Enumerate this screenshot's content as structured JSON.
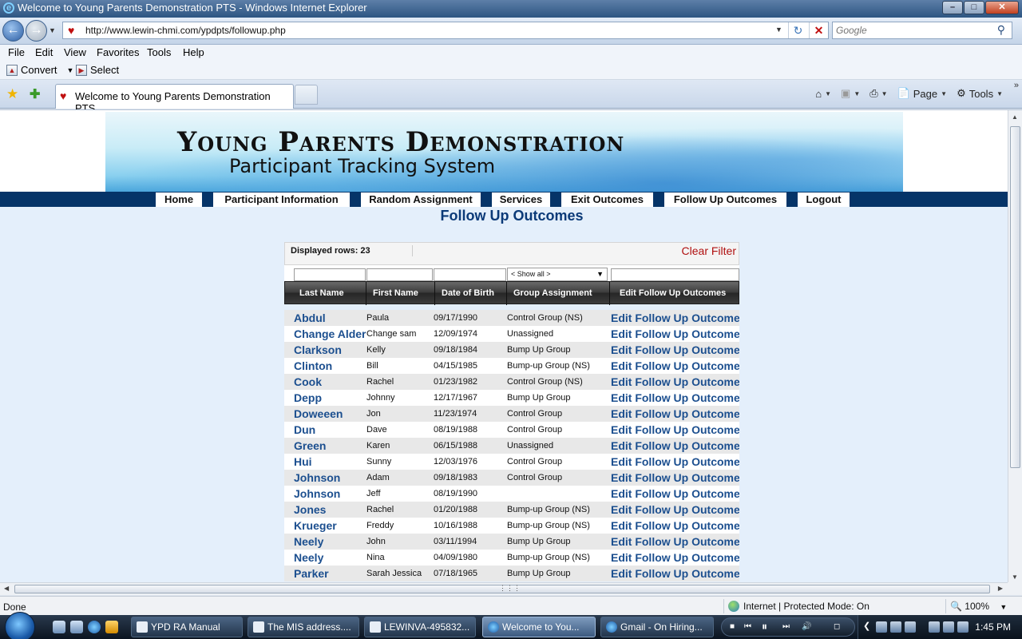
{
  "window": {
    "title": "Welcome to Young Parents Demonstration PTS - Windows Internet Explorer",
    "min": "–",
    "max": "□",
    "close": "✕"
  },
  "browser": {
    "url": "http://www.lewin-chmi.com/ypdpts/followup.php",
    "search_placeholder": "Google",
    "menu": [
      "File",
      "Edit",
      "View",
      "Favorites",
      "Tools",
      "Help"
    ],
    "cmd_convert": "Convert",
    "cmd_select": "Select",
    "tab_title": "Welcome to Young Parents Demonstration PTS",
    "tool_page": "Page",
    "tool_tools": "Tools"
  },
  "banner": {
    "title": "Young Parents Demonstration",
    "subtitle": "Participant Tracking System"
  },
  "site_nav": [
    "Home",
    "Participant Information",
    "Random Assignment",
    "Services",
    "Exit Outcomes",
    "Follow Up Outcomes",
    "Logout"
  ],
  "page_title": "Follow Up Outcomes",
  "grid": {
    "displayed_rows": "Displayed rows: 23",
    "clear_filter": "Clear Filter",
    "group_filter": "< Show all >",
    "columns": [
      "Last Name",
      "First Name",
      "Date of Birth",
      "Group Assignment",
      "Edit Follow Up Outcomes"
    ],
    "edit_link": "Edit Follow Up Outcomes",
    "rows": [
      [
        "Abdul",
        "Paula",
        "09/17/1990",
        "Control Group (NS)"
      ],
      [
        "Change Alder",
        "Change sam",
        "12/09/1974",
        "Unassigned"
      ],
      [
        "Clarkson",
        "Kelly",
        "09/18/1984",
        "Bump Up Group"
      ],
      [
        "Clinton",
        "Bill",
        "04/15/1985",
        "Bump-up Group (NS)"
      ],
      [
        "Cook",
        "Rachel",
        "01/23/1982",
        "Control Group (NS)"
      ],
      [
        "Depp",
        "Johnny",
        "12/17/1967",
        "Bump Up Group"
      ],
      [
        "Doweeen",
        "Jon",
        "11/23/1974",
        "Control Group"
      ],
      [
        "Dun",
        "Dave",
        "08/19/1988",
        "Control Group"
      ],
      [
        "Green",
        "Karen",
        "06/15/1988",
        "Unassigned"
      ],
      [
        "Hui",
        "Sunny",
        "12/03/1976",
        "Control Group"
      ],
      [
        "Johnson",
        "Adam",
        "09/18/1983",
        "Control Group"
      ],
      [
        "Johnson",
        "Jeff",
        "08/19/1990",
        ""
      ],
      [
        "Jones",
        "Rachel",
        "01/20/1988",
        "Bump-up Group (NS)"
      ],
      [
        "Krueger",
        "Freddy",
        "10/16/1988",
        "Bump-up Group (NS)"
      ],
      [
        "Neely",
        "John",
        "03/11/1994",
        "Bump Up Group"
      ],
      [
        "Neely",
        "Nina",
        "04/09/1980",
        "Bump-up Group (NS)"
      ],
      [
        "Parker",
        "Sarah Jessica",
        "07/18/1965",
        "Bump Up Group"
      ]
    ]
  },
  "status": {
    "text": "Done",
    "zone": "Internet | Protected Mode: On",
    "zoom": "100%"
  },
  "taskbar": {
    "tasks": [
      "YPD RA Manual",
      "The MIS address....",
      "LEWINVA-495832...",
      "Welcome to You...",
      "Gmail - On Hiring..."
    ],
    "clock": "1:45 PM"
  }
}
